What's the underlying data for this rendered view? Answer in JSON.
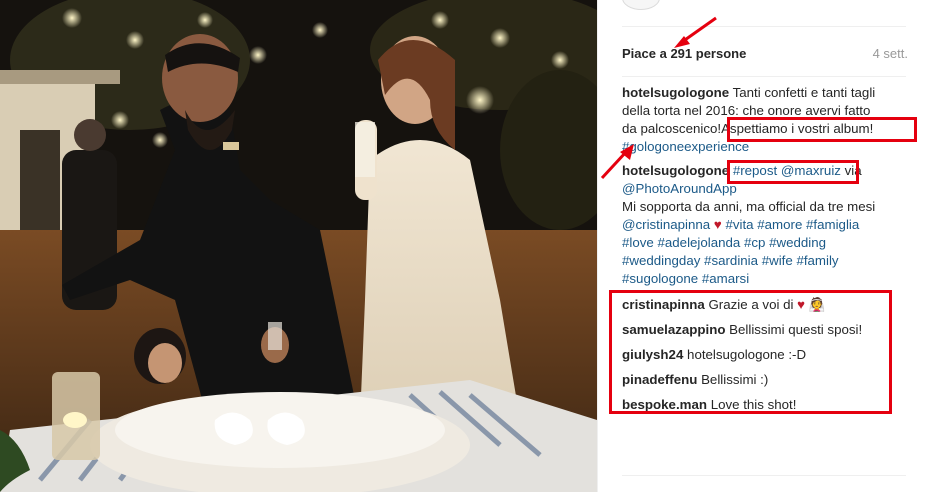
{
  "post": {
    "likes_prefix": "Piace a ",
    "likes_count": "291",
    "likes_suffix": " persone",
    "time_ago": "4 sett."
  },
  "caption_1": {
    "user": "hotelsugologone",
    "text_a": "Tanti confetti e tanti tagli",
    "text_b": "della torta nel 2016: che onore avervi fatto",
    "text_c": "da palcoscenico!",
    "text_highlight": "Aspettiamo i vostri album!",
    "tag": "#gologoneexperience"
  },
  "caption_2": {
    "user": "hotelsugologone",
    "tag_repost": "#repost",
    "mention": "@maxruiz",
    "text_via": "via",
    "mention2": "@PhotoAroundApp",
    "text_a": "Mi sopporta da anni, ma official da tre mesi",
    "mention3": "@cristinapinna",
    "heart": "♥",
    "tags_line1": "#vita #amore #famiglia",
    "tags_line2": "#love #adelejolanda #cp #wedding",
    "tags_line3": "#weddingday #sardinia #wife #family",
    "tags_line4": "#sugologone #amarsi"
  },
  "comments": [
    {
      "user": "cristinapinna",
      "text": "Grazie a voi di",
      "emoji": "♥ 👰"
    },
    {
      "user": "samuelazappino",
      "text": "Bellissimi questi sposi!"
    },
    {
      "user": "giulysh24",
      "text": "hotelsugologone :-D"
    },
    {
      "user": "pinadeffenu",
      "text": "Bellissimi :)"
    },
    {
      "user": "bespoke.man",
      "text": "Love this shot!"
    }
  ],
  "colors": {
    "annotation": "#e5000f",
    "hashtag": "#1c5a88",
    "text": "#262626",
    "muted": "#999999"
  }
}
